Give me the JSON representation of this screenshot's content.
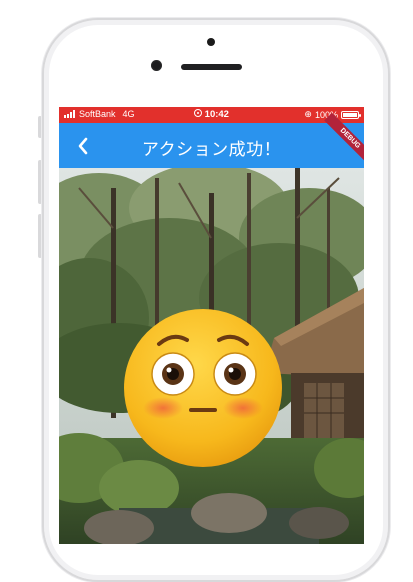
{
  "status_bar": {
    "carrier": "SoftBank",
    "network": "4G",
    "time": "10:42",
    "battery": "100%",
    "battery_level": 1.0,
    "background": "#e2302c"
  },
  "app_bar": {
    "back_icon": "chevron-left-icon",
    "title": "アクション成功！",
    "debug_banner": "DEBUG",
    "color": "#2a93ee"
  },
  "content": {
    "background_image": "garden-with-thatched-hut-photo",
    "overlay_emoji": "flushed-face-emoji"
  }
}
